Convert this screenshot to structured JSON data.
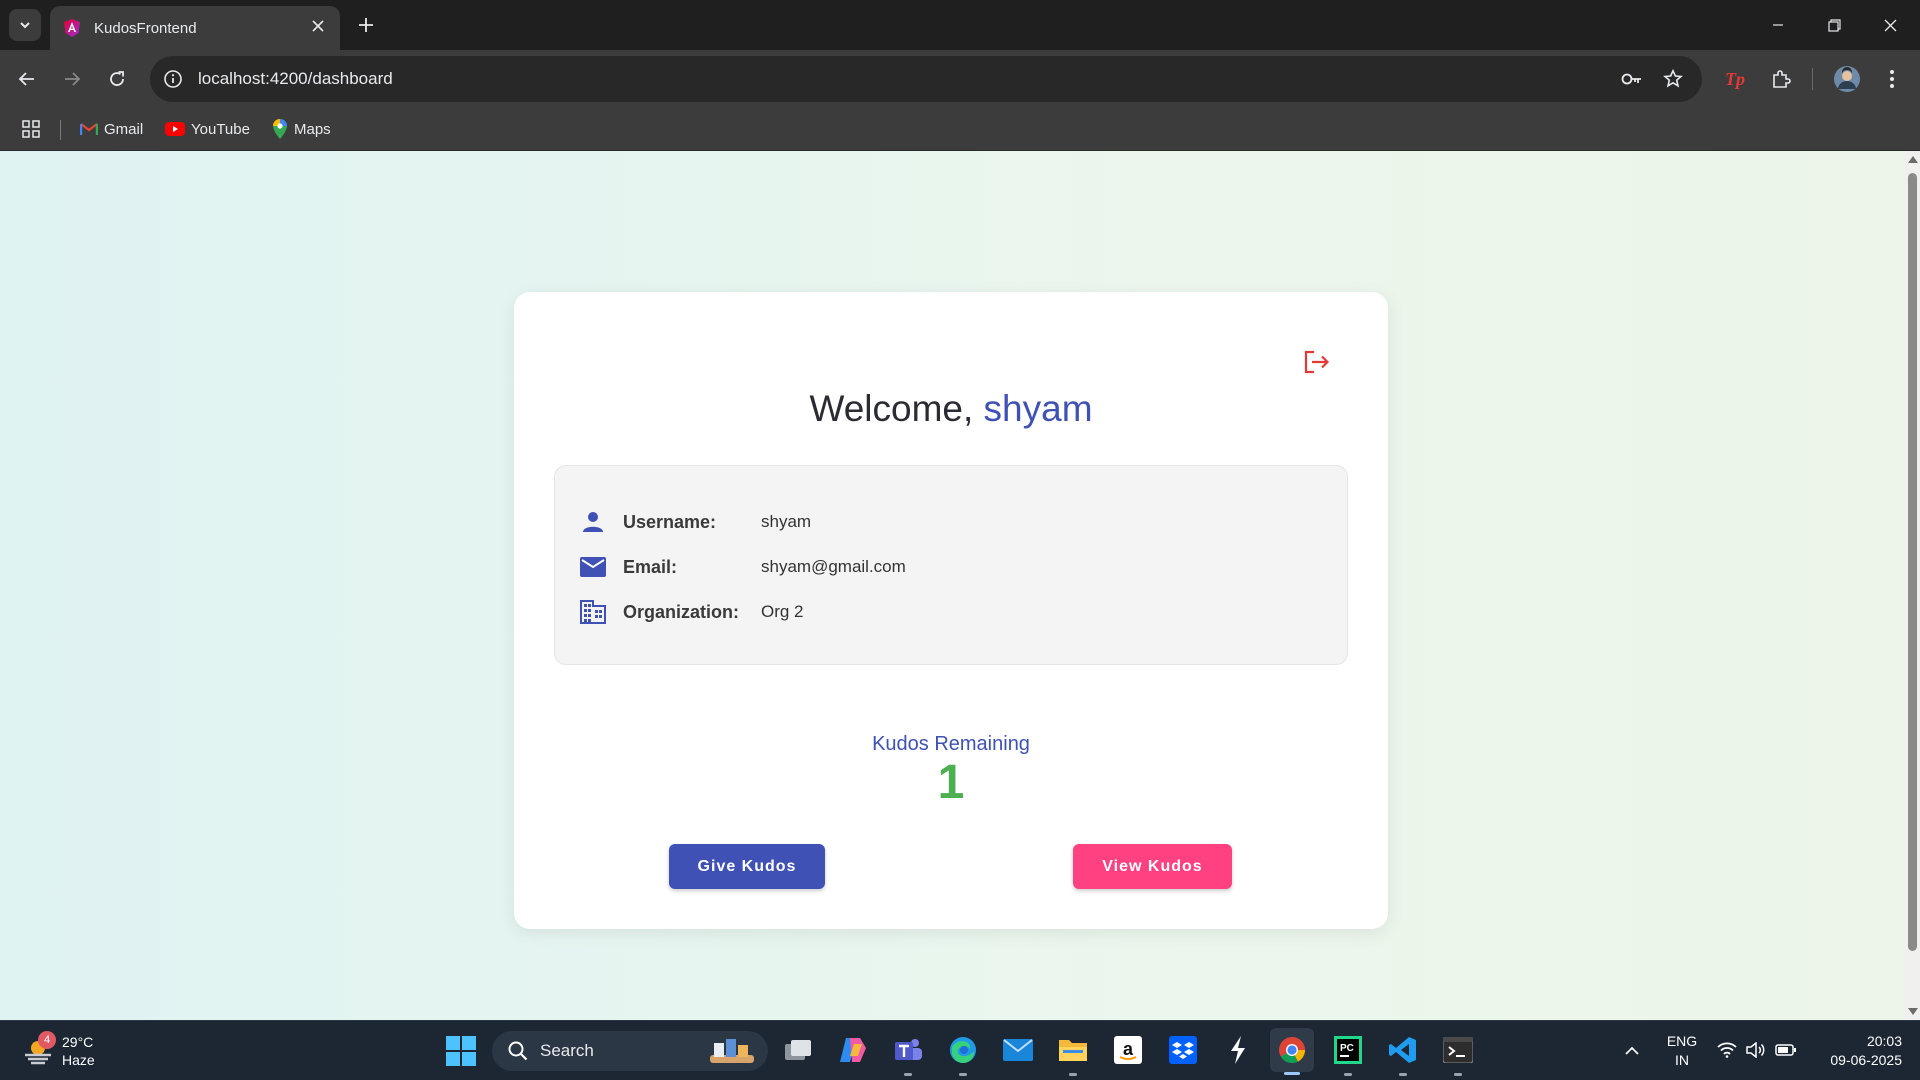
{
  "browser": {
    "tab_title": "KudosFrontend",
    "url": "localhost:4200/dashboard",
    "bookmarks": [
      {
        "label": "Gmail"
      },
      {
        "label": "YouTube"
      },
      {
        "label": "Maps"
      }
    ]
  },
  "page": {
    "welcome_prefix": "Welcome, ",
    "welcome_name": "shyam",
    "profile": {
      "username_label": "Username:",
      "username_value": "shyam",
      "email_label": "Email:",
      "email_value": "shyam@gmail.com",
      "org_label": "Organization:",
      "org_value": "Org 2"
    },
    "kudos_label": "Kudos Remaining",
    "kudos_count": "1",
    "give_button": "Give Kudos",
    "view_button": "View Kudos"
  },
  "taskbar": {
    "weather_badge": "4",
    "weather_temp": "29°C",
    "weather_desc": "Haze",
    "search_label": "Search",
    "lang_line1": "ENG",
    "lang_line2": "IN",
    "time": "20:03",
    "date": "09-06-2025"
  },
  "colors": {
    "primary": "#3f51b5",
    "accent": "#ff4081",
    "kudos_count": "#4caf50",
    "logout": "#e53935"
  },
  "icons": [
    "tab-search-icon",
    "close-icon",
    "plus-icon",
    "back-icon",
    "forward-icon",
    "reload-icon",
    "info-icon",
    "key-icon",
    "star-icon",
    "extensions-icon",
    "logout-icon",
    "person-icon",
    "mail-icon",
    "building-icon"
  ]
}
